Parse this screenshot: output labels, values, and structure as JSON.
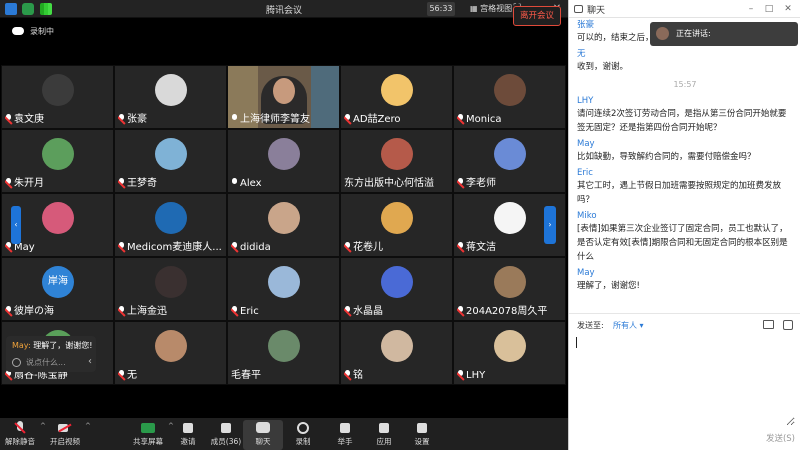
{
  "window": {
    "title": "腾讯会议",
    "timer": "56:33",
    "view_label": "宫格视图"
  },
  "recording": {
    "label": "录制中"
  },
  "tiles": [
    {
      "name": "袁文庚",
      "avatar_color": "#3b3b3b",
      "mic": "muted"
    },
    {
      "name": "张豪",
      "avatar_color": "#d9d9d9",
      "mic": "muted"
    },
    {
      "name": "上海律师李箐友",
      "avatar_color": "#6a5a48",
      "mic": "on"
    },
    {
      "name": "AD喆Zero",
      "avatar_color": "#f2c46a",
      "mic": "muted"
    },
    {
      "name": "Monica",
      "avatar_color": "#6d4b3a",
      "mic": "muted"
    },
    {
      "name": "朱开月",
      "avatar_color": "#5c9e5c",
      "mic": "muted"
    },
    {
      "name": "王梦奇",
      "avatar_color": "#7fb2d6",
      "mic": "muted"
    },
    {
      "name": "Alex",
      "avatar_color": "#8a7f9a",
      "mic": "on"
    },
    {
      "name": "东方出版中心何恬溢",
      "avatar_color": "#b55a4a",
      "mic": "none"
    },
    {
      "name": "李老师",
      "avatar_color": "#6a8bd6",
      "mic": "muted"
    },
    {
      "name": "May",
      "avatar_color": "#d65a7a",
      "mic": "muted"
    },
    {
      "name": "Medicom麦迪康人...",
      "avatar_color": "#1f6ab3",
      "mic": "muted"
    },
    {
      "name": "didida",
      "avatar_color": "#c9a58a",
      "mic": "muted"
    },
    {
      "name": "花卷儿",
      "avatar_color": "#e0a850",
      "mic": "muted"
    },
    {
      "name": "蒋文洁",
      "avatar_color": "#f5f5f5",
      "mic": "muted"
    },
    {
      "name": "彼岸の海",
      "avatar_color": "#2f83d6",
      "avatar_text": "岸海",
      "mic": "muted"
    },
    {
      "name": "上海金迅",
      "avatar_color": "#3a3030",
      "mic": "muted"
    },
    {
      "name": "Eric",
      "avatar_color": "#9ab8d9",
      "mic": "muted"
    },
    {
      "name": "水晶晶",
      "avatar_color": "#4a6ad6",
      "mic": "muted"
    },
    {
      "name": "204A2078周久平",
      "avatar_color": "#9a7a5a",
      "mic": "muted"
    },
    {
      "name": "扇谷-陈宝静",
      "avatar_color": "#5aa05a",
      "mic": "muted"
    },
    {
      "name": "无",
      "avatar_color": "#b88a6a",
      "mic": "muted"
    },
    {
      "name": "毛春平",
      "avatar_color": "#6a8a6a",
      "mic": "none"
    },
    {
      "name": "铭",
      "avatar_color": "#d0b8a0",
      "mic": "muted"
    },
    {
      "name": "LHY",
      "avatar_color": "#d9c09a",
      "mic": "muted"
    }
  ],
  "popup": {
    "user": "May:",
    "message": " 理解了，谢谢您!",
    "input_placeholder": "说点什么..."
  },
  "toolbar": {
    "items": [
      {
        "label": "解除静音",
        "icon": "mic-muted-icon"
      },
      {
        "label": "开启视频",
        "icon": "video-off-icon"
      },
      {
        "label": "共享屏幕",
        "icon": "share-screen-icon"
      },
      {
        "label": "邀请",
        "icon": "invite-icon"
      },
      {
        "label": "成员(36)",
        "icon": "members-icon"
      },
      {
        "label": "聊天",
        "icon": "chat-icon"
      },
      {
        "label": "录制",
        "icon": "record-icon"
      },
      {
        "label": "举手",
        "icon": "raise-hand-icon"
      },
      {
        "label": "应用",
        "icon": "apps-icon"
      },
      {
        "label": "设置",
        "icon": "settings-icon"
      }
    ],
    "leave_label": "离开会议"
  },
  "chat": {
    "title": "聊天",
    "speaking_label": "正在讲话:",
    "messages": [
      {
        "type": "msg",
        "sender": "张豪",
        "text": "可以的，结束之后，李律师会把ppt分享给大家。"
      },
      {
        "type": "msg",
        "sender": "无",
        "text": "收到，谢谢。"
      },
      {
        "type": "time",
        "text": "15:57"
      },
      {
        "type": "msg",
        "sender": "LHY",
        "text": "请问连续2次签订劳动合同，是指从第三份合同开始就要签无固定？还是指第四份合同开始呢？"
      },
      {
        "type": "msg",
        "sender": "May",
        "text": "比如缺勤，导致解约合同的，需要付赔偿金吗？"
      },
      {
        "type": "msg",
        "sender": "Eric",
        "text": "其它工时，遇上节假日加班需要按照规定的加班费发放吗？"
      },
      {
        "type": "msg",
        "sender": "Miko",
        "text": "[表情]如果第三次企业签订了固定合同，员工也默认了，是否认定有效[表情]期限合同和无固定合同的根本区别是什么"
      },
      {
        "type": "msg",
        "sender": "May",
        "text": "理解了，谢谢您!"
      }
    ],
    "send_to_label": "发送至:",
    "send_to_value": "所有人 ▾",
    "send_label": "发送(S)"
  }
}
